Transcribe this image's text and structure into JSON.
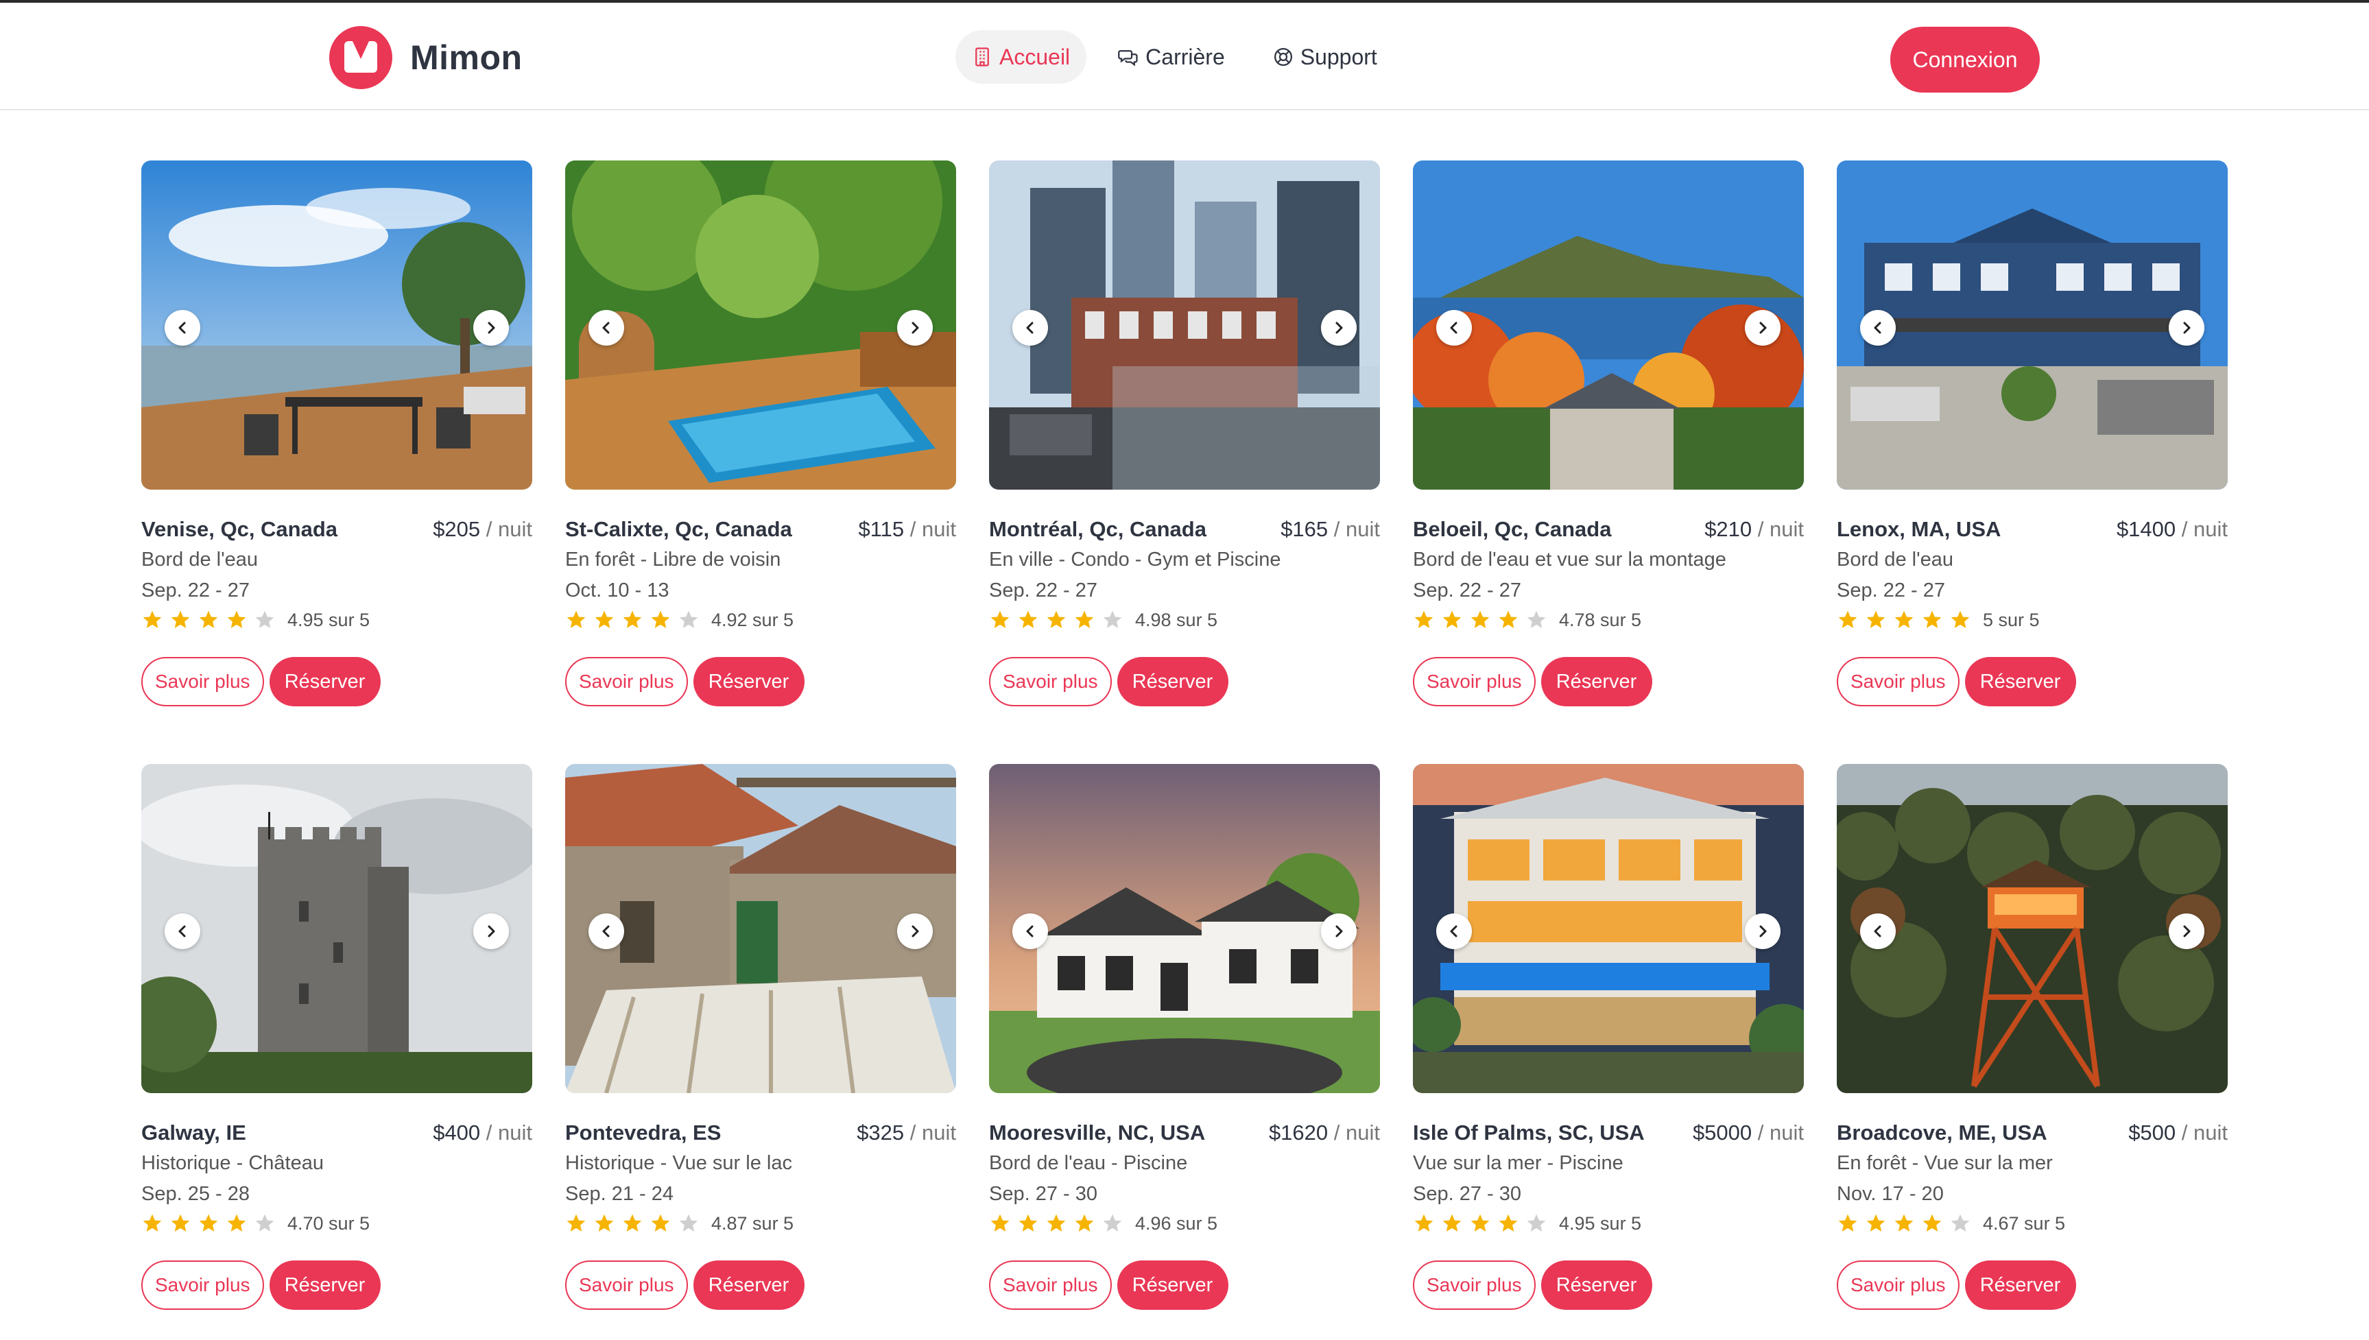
{
  "brand": {
    "name": "Mimon",
    "accent": "#ea3755"
  },
  "nav": {
    "items": [
      {
        "label": "Accueil",
        "icon": "building-icon",
        "active": true
      },
      {
        "label": "Carrière",
        "icon": "chat-bubbles-icon",
        "active": false
      },
      {
        "label": "Support",
        "icon": "lifebuoy-icon",
        "active": false
      }
    ],
    "login_label": "Connexion"
  },
  "labels": {
    "per_night": "/ nuit",
    "learn_more": "Savoir plus",
    "book": "Réserver"
  },
  "listings": [
    {
      "city": "Venise, Qc, Canada",
      "price": "$205",
      "desc": "Bord de l'eau",
      "dates": "Sep. 22 - 27",
      "stars": 4,
      "rating": "4.95 sur 5",
      "scene": "lake-terrace"
    },
    {
      "city": "St-Calixte, Qc, Canada",
      "price": "$115",
      "desc": "En forêt - Libre de voisin",
      "dates": "Oct. 10 - 13",
      "stars": 4,
      "rating": "4.92 sur 5",
      "scene": "forest-pool"
    },
    {
      "city": "Montréal, Qc, Canada",
      "price": "$165",
      "desc": "En ville - Condo - Gym et Piscine",
      "dates": "Sep. 22 - 27",
      "stars": 4,
      "rating": "4.98 sur 5",
      "scene": "city-rooftop"
    },
    {
      "city": "Beloeil, Qc, Canada",
      "price": "$210",
      "desc": "Bord de l'eau et vue sur la montage",
      "dates": "Sep. 22 - 27",
      "stars": 4,
      "rating": "4.78 sur 5",
      "scene": "autumn-mountain"
    },
    {
      "city": "Lenox, MA, USA",
      "price": "$1400",
      "desc": "Bord de l'eau",
      "dates": "Sep. 22 - 27",
      "stars": 5,
      "rating": "5 sur 5",
      "scene": "blue-mansion"
    },
    {
      "city": "Galway, IE",
      "price": "$400",
      "desc": "Historique - Château",
      "dates": "Sep. 25 - 28",
      "stars": 4,
      "rating": "4.70 sur 5",
      "scene": "stone-castle"
    },
    {
      "city": "Pontevedra, ES",
      "price": "$325",
      "desc": "Historique - Vue sur le lac",
      "dates": "Sep. 21 - 24",
      "stars": 4,
      "rating": "4.87 sur 5",
      "scene": "stone-patio"
    },
    {
      "city": "Mooresville, NC, USA",
      "price": "$1620",
      "desc": "Bord de l'eau - Piscine",
      "dates": "Sep. 27 - 30",
      "stars": 4,
      "rating": "4.96 sur 5",
      "scene": "white-house"
    },
    {
      "city": "Isle Of Palms, SC, USA",
      "price": "$5000",
      "desc": "Vue sur la mer - Piscine",
      "dates": "Sep. 27 - 30",
      "stars": 4,
      "rating": "4.95 sur 5",
      "scene": "beach-villa"
    },
    {
      "city": "Broadcove, ME, USA",
      "price": "$500",
      "desc": "En forêt - Vue sur la mer",
      "dates": "Nov. 17 - 20",
      "stars": 4,
      "rating": "4.67 sur 5",
      "scene": "fire-tower"
    }
  ]
}
